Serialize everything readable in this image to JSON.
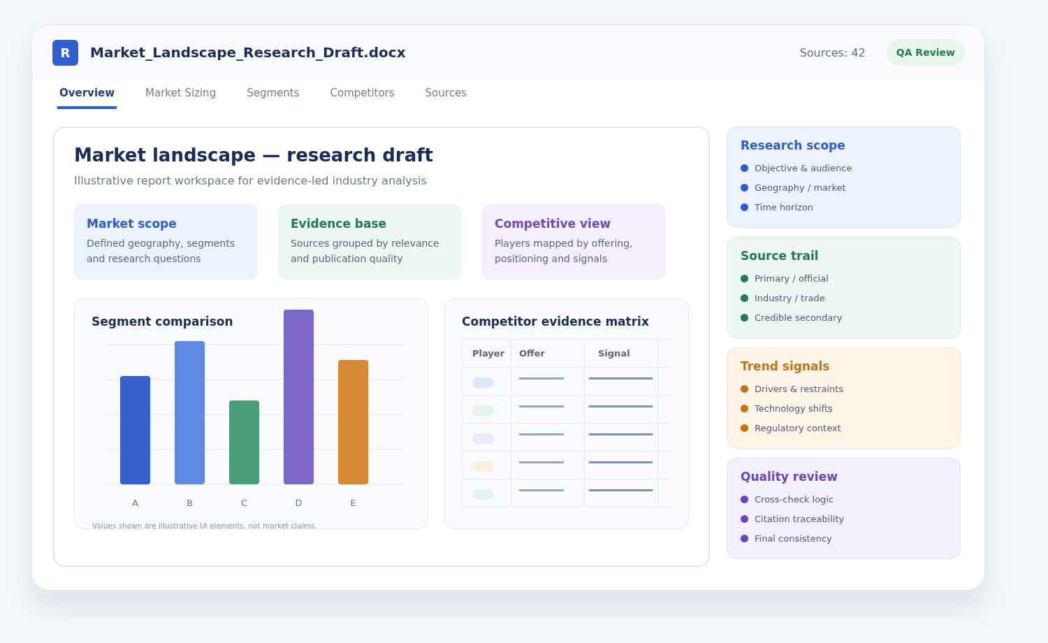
{
  "header": {
    "logo": "R",
    "title": "Market_Landscape_Research_Draft.docx",
    "sources": "Sources: 42",
    "status_badge": "QA Review"
  },
  "tabs": [
    {
      "label": "Overview",
      "selected": true
    },
    {
      "label": "Market Sizing",
      "selected": false
    },
    {
      "label": "Segments",
      "selected": false
    },
    {
      "label": "Competitors",
      "selected": false
    },
    {
      "label": "Sources",
      "selected": false
    }
  ],
  "main": {
    "title": "Market landscape — research draft",
    "subtitle": "Illustrative report workspace for evidence-led industry analysis",
    "cards": [
      {
        "title": "Market scope",
        "text": "Defined geography, segments and research questions",
        "color": "#2f5bd1"
      },
      {
        "title": "Evidence base",
        "text": "Sources grouped by relevance and publication quality",
        "color": "#1f7a55"
      },
      {
        "title": "Competitive view",
        "text": "Players mapped by offering, positioning and signals",
        "color": "#7048c0"
      }
    ],
    "segment_chart": {
      "title": "Segment comparison",
      "bars": [
        {
          "label": "A",
          "color": "#3760cc"
        },
        {
          "label": "B",
          "color": "#5f8ae4"
        },
        {
          "label": "C",
          "color": "#4a9e7a"
        },
        {
          "label": "D",
          "color": "#7b67c6"
        },
        {
          "label": "E",
          "color": "#d98935"
        }
      ],
      "footnote": "Values shown are illustrative UI elements, not market claims."
    },
    "matrix": {
      "title": "Competitor evidence matrix",
      "columns": [
        "Player",
        "Offer",
        "Signal"
      ],
      "rows": [
        {
          "color": "#dde8fd"
        },
        {
          "color": "#e3f3eb"
        },
        {
          "color": "#efe8fc"
        },
        {
          "color": "#fdeedd"
        },
        {
          "color": "#e3f4f3"
        }
      ]
    }
  },
  "side_panels": [
    {
      "title": "Research scope",
      "color": "#2f5bd1",
      "items": [
        "Objective & audience",
        "Geography / market",
        "Time horizon"
      ]
    },
    {
      "title": "Source trail",
      "color": "#1f7a55",
      "items": [
        "Primary / official",
        "Industry / trade",
        "Credible secondary"
      ]
    },
    {
      "title": "Trend signals",
      "color": "#c27414",
      "items": [
        "Drivers & restraints",
        "Technology shifts",
        "Regulatory context"
      ]
    },
    {
      "title": "Quality review",
      "color": "#6a45bd",
      "items": [
        "Cross-check logic",
        "Citation traceability",
        "Final consistency"
      ]
    }
  ]
}
